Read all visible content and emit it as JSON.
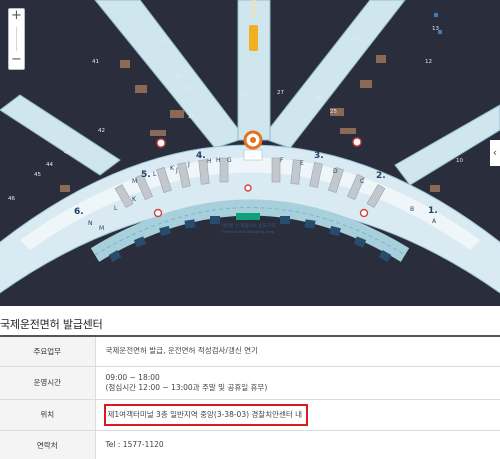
{
  "map": {
    "zoom_in": "+",
    "zoom_out": "−",
    "next_arrow": "‹",
    "gates_top_left": [
      "31",
      "41",
      "30",
      "29",
      "28"
    ],
    "gates_top_right": [
      "27",
      "26",
      "25",
      "24",
      "13",
      "12"
    ],
    "gates_left": [
      "42",
      "43",
      "44",
      "45",
      "46"
    ],
    "gates_right": [
      "11",
      "10"
    ],
    "gate_23": "23",
    "section_numbers": [
      "4.",
      "3.",
      "5.",
      "2.",
      "6.",
      "1."
    ],
    "counters_left": [
      "M",
      "L",
      "K",
      "J",
      "H",
      "G"
    ],
    "counters_right": [
      "F",
      "E",
      "D",
      "C",
      "B",
      "A"
    ],
    "counters_bottom_left": [
      "N",
      "M",
      "L",
      "K",
      "J",
      "H"
    ],
    "bus_area_line1": "미터발 인 제플러스 승차구역",
    "bus_area_line2": "Terminal Bus Boarding Area"
  },
  "heading": "국제운전면허 발급센터",
  "rows": [
    {
      "label": "주요업무",
      "lines": [
        "국제운전면허 발급, 운전면허 적성검사/갱신 연기"
      ]
    },
    {
      "label": "운영시간",
      "lines": [
        "09:00 ~ 18:00",
        "(점심시간 12:00 ~ 13:00과 주말 및 공휴일 휴무)"
      ]
    },
    {
      "label": "위치",
      "lines": [
        "제1여객터미널 3층 일반지역 중앙(3-38-03) 경찰치안센터 내"
      ]
    },
    {
      "label": "연락처",
      "lines": [
        "Tel : 1577-1120"
      ]
    }
  ],
  "colors": {
    "map_background": "#2a2d3b",
    "terminal_floor": "#d9eaf2",
    "highlight_border": "#d61e1e",
    "bus_area": "#12a07a"
  }
}
